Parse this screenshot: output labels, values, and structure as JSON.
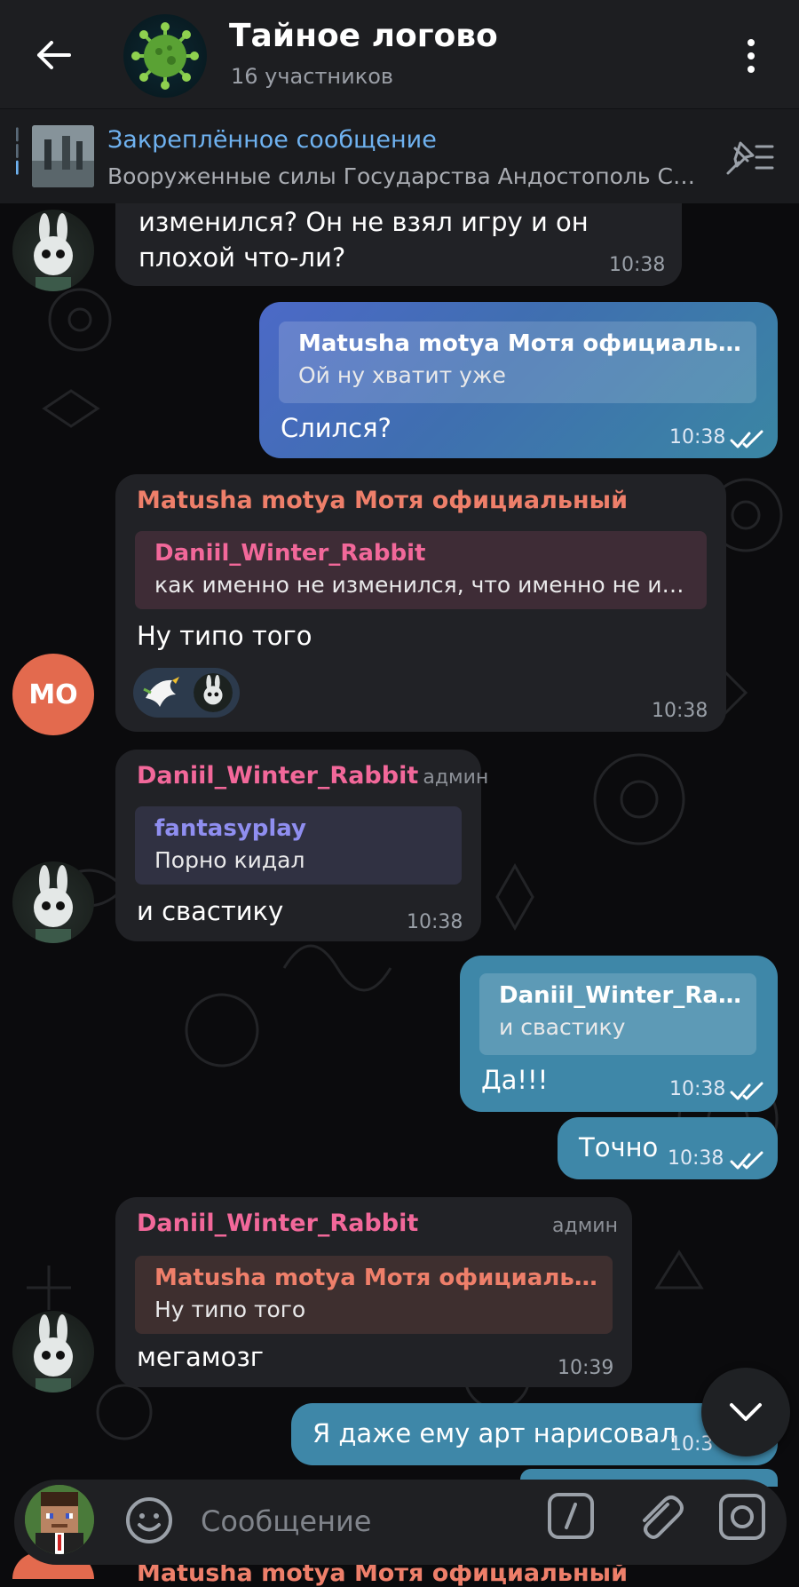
{
  "header": {
    "title": "Тайное логово",
    "subtitle": "16 участников"
  },
  "pinned": {
    "title": "Закреплённое сообщение",
    "text": "Вооруженные силы Государства Андостополь  Сол..."
  },
  "messages": [
    {
      "text": "изменился? Он не взял игру и он плохой что-ли?",
      "time": "10:38"
    },
    {
      "reply_name": "Matusha motya Мотя официальный",
      "reply_text": "Ой ну хватит уже",
      "text": "Слился?",
      "time": "10:38"
    },
    {
      "sender": "Matusha motya Мотя официальный",
      "avatar_initials": "MO",
      "reply_name": "Daniil_Winter_Rabbit",
      "reply_text": "как именно не изменился, что именно не изме...",
      "text": "Ну типо того",
      "time": "10:38"
    },
    {
      "sender": "Daniil_Winter_Rabbit",
      "badge": "админ",
      "reply_name": "fantasyplay",
      "reply_text": "Порно кидал",
      "text": "и свастику",
      "time": "10:38"
    },
    {
      "reply_name": "Daniil_Winter_Rabbit",
      "reply_text": "и свастику",
      "text": "Да!!!",
      "time": "10:38"
    },
    {
      "text": "Точно",
      "time": "10:38"
    },
    {
      "sender": "Daniil_Winter_Rabbit",
      "badge": "админ",
      "reply_name": "Matusha motya Мотя официальный",
      "reply_text": "Ну типо того",
      "text": "мегамозг",
      "time": "10:39"
    },
    {
      "text": "Я даже ему арт нарисовал",
      "time": "10:3"
    }
  ],
  "partial_sender": "Matusha motya Мотя официальный",
  "input": {
    "placeholder": "Сообщение"
  },
  "colors": {
    "header_bg": "#1d1e21",
    "incoming_bubble": "#212226",
    "outgoing_bubble_start": "#4c69c7",
    "outgoing_bubble_end": "#3a86a3",
    "pin_title": "#6fb2f0",
    "name_salmon": "#ee7f6a",
    "name_pink": "#f2689a",
    "name_violet": "#8f8ef0"
  },
  "icons": {
    "back": "arrow-left-icon",
    "menu": "more-vertical-icon",
    "pin_list": "pin-list-icon",
    "emoji": "smile-icon",
    "commands": "slash-command-icon",
    "attach": "paperclip-icon",
    "camera": "camera-icon",
    "scroll_down": "chevron-down-icon",
    "read": "double-check-icon"
  }
}
